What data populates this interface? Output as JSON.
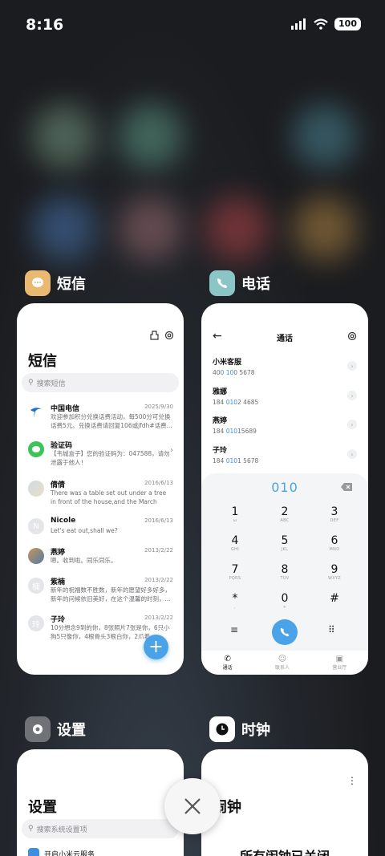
{
  "status_bar": {
    "time": "8:16",
    "battery": "100"
  },
  "apps": {
    "sms": {
      "name": "短信",
      "title": "短信",
      "search_placeholder": "搜索短信",
      "messages": [
        {
          "name": "中国电信",
          "date": "2025/9/30",
          "preview": "欢迎参加积分兑换话费活动，每500分可兑换话费5元。兑换话费请回复106或jfdh#话费..."
        },
        {
          "name": "验证码",
          "date": "",
          "preview": "【韦城盒子】您的验证码为：047588，请勿泄露于他人！"
        },
        {
          "name": "倩倩",
          "date": "2016/6/13",
          "preview": "There was a table set out under a tree in front of the house,and the March Hare an..."
        },
        {
          "name": "Nicole",
          "date": "2016/6/13",
          "preview": "Let's eat out,shall we?"
        },
        {
          "name": "燕婷",
          "date": "2013/2/22",
          "preview": "嗯。收到啦。同乐同乐。"
        },
        {
          "name": "紫楠",
          "date": "2013/2/22",
          "preview": "新年的祝福数不胜数，新年的愿望好多好多，新年的问候依旧美好，在这个温馨的时刻，..."
        },
        {
          "name": "子玲",
          "date": "2013/2/22",
          "preview": "10分想念9到的你，8张照片7张是你，6只小狗5只像你，4根骨头3根白你，2爪着..."
        }
      ],
      "avatar_letters": {
        "nicole": "N",
        "zinan": "楠",
        "ziling": "玲"
      }
    },
    "phone": {
      "name": "电话",
      "title": "通话",
      "contacts": [
        {
          "name": "小米客服",
          "number_pre": "40",
          "number_hl": "0",
          "number_mid": " ",
          "number_hl2": "10",
          "number_post": "0 5678"
        },
        {
          "name": "雅娜",
          "number_pre": "184 ",
          "number_hl": "010",
          "number_mid": "2 4685",
          "number_hl2": "",
          "number_post": ""
        },
        {
          "name": "燕婷",
          "number_pre": "184 ",
          "number_hl": "010",
          "number_mid": "15689",
          "number_hl2": "",
          "number_post": ""
        },
        {
          "name": "子玲",
          "number_pre": "184 ",
          "number_hl": "010",
          "number_mid": "1 5678",
          "number_hl2": "",
          "number_post": ""
        }
      ],
      "dial_input": "010",
      "keys": [
        {
          "d": "1",
          "l": "ω"
        },
        {
          "d": "2",
          "l": "ABC"
        },
        {
          "d": "3",
          "l": "DEF"
        },
        {
          "d": "4",
          "l": "GHI"
        },
        {
          "d": "5",
          "l": "JKL"
        },
        {
          "d": "6",
          "l": "MNO"
        },
        {
          "d": "7",
          "l": "PQRS"
        },
        {
          "d": "8",
          "l": "TUV"
        },
        {
          "d": "9",
          "l": "WXYZ"
        },
        {
          "d": "*",
          "l": ","
        },
        {
          "d": "0",
          "l": "+"
        },
        {
          "d": "#",
          "l": ""
        }
      ],
      "tabs": [
        "通话",
        "联系人",
        "营业厅"
      ]
    },
    "settings": {
      "name": "设置",
      "title": "设置",
      "search_placeholder": "搜索系统设置项",
      "first_item": "开启小米云服务"
    },
    "clock": {
      "name": "时钟",
      "title": "闹钟",
      "empty_text": "所有闹钟已关闭"
    }
  },
  "colors": {
    "accent_blue": "#4aa3e8",
    "sms_icon": "#e9b871",
    "phone_icon": "#8bc5c5",
    "highlight": "#3d8ee0"
  }
}
